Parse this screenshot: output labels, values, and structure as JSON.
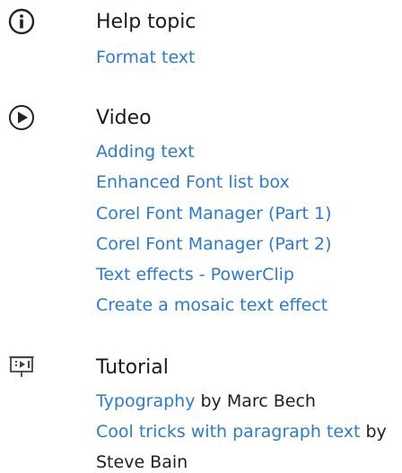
{
  "help": {
    "icon": "info-icon",
    "title": "Help topic",
    "links": [
      "Format text"
    ]
  },
  "video": {
    "icon": "play-icon",
    "title": "Video",
    "links": [
      "Adding text",
      "Enhanced Font list box",
      "Corel Font Manager (Part 1)",
      "Corel Font Manager (Part 2)",
      "Text effects - PowerClip",
      "Create a mosaic text effect"
    ]
  },
  "tutorial": {
    "icon": "presentation-icon",
    "title": "Tutorial",
    "items": [
      {
        "link": "Typography",
        "by": " by Marc Bech"
      },
      {
        "link": "Cool tricks with paragraph text",
        "by": " by",
        "continuation": "Steve Bain"
      }
    ]
  },
  "colors": {
    "link": "#2b7bd0",
    "text": "#1f1f1f",
    "icon": "#222222"
  }
}
